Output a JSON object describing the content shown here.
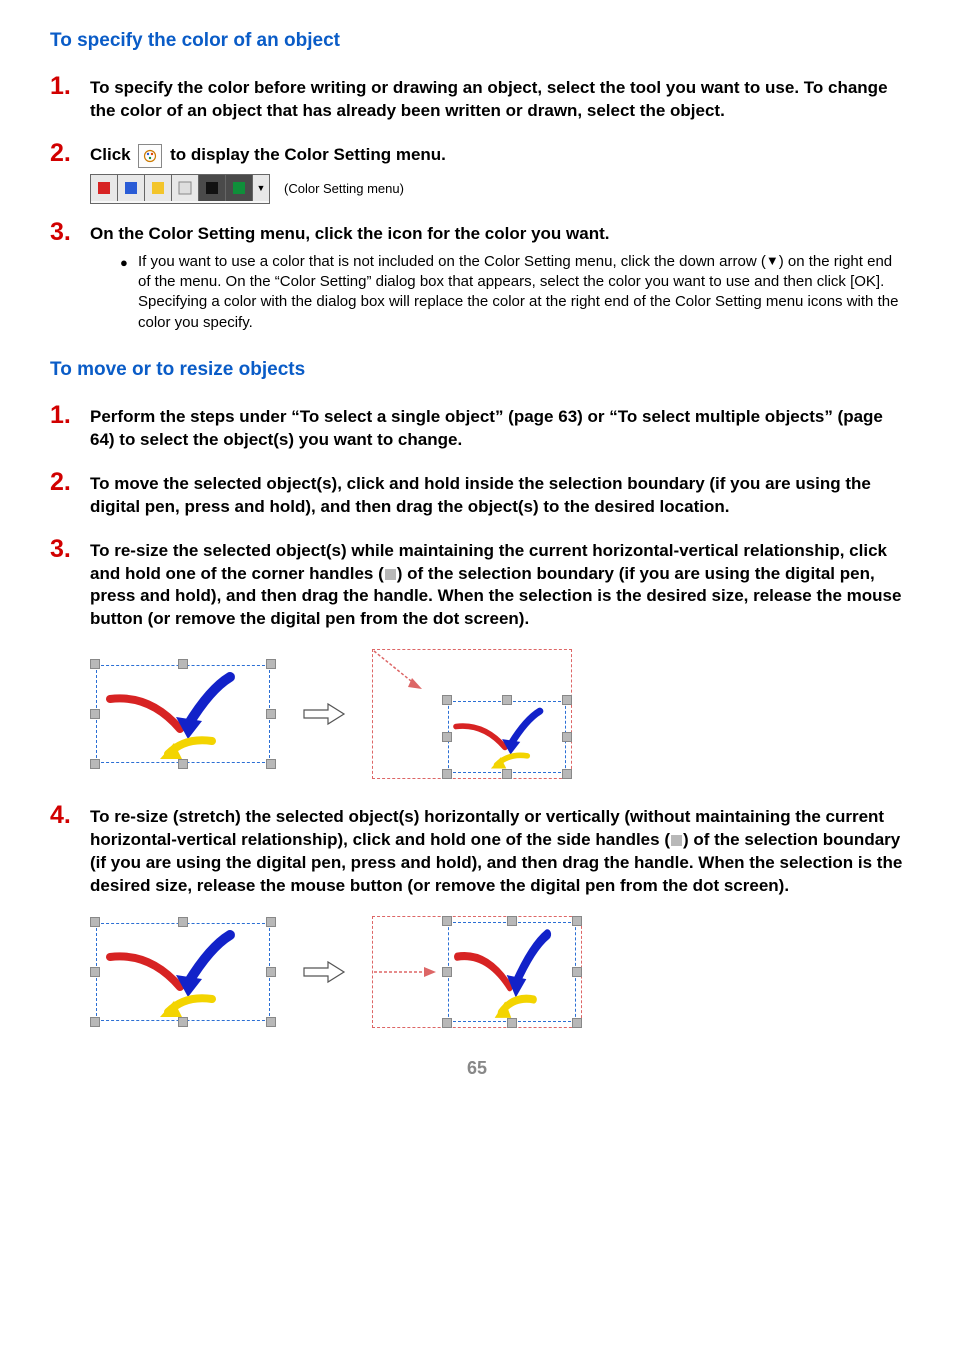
{
  "section1": {
    "heading": "To specify the color of an object",
    "step1": "To specify the color before writing or drawing an object, select the tool you want to use. To change the color of an object that has already been written or drawn, select the object.",
    "step2_pre": "Click ",
    "step2_post": " to display the Color Setting menu.",
    "menu_label": "(Color Setting menu)",
    "swatches": [
      "#d72323",
      "#2a5cd6",
      "#f3c52b",
      "#dedede",
      "#111111",
      "#0f8f3a"
    ],
    "step3": "On the Color Setting menu, click the icon for the color you want.",
    "step3_bullet_pre": "If you want to use a color that is not included on the Color Setting menu, click the down arrow (",
    "step3_bullet_post": ") on the right end of the menu. On the “Color Setting” dialog box that appears, select the color you want to use and then click [OK]. Specifying a color with the dialog box will replace the color at the right end of the Color Setting menu icons with the color you specify."
  },
  "section2": {
    "heading": "To move or to resize objects",
    "step1": "Perform the steps under “To select a single object” (page 63) or “To select multiple objects” (page 64) to select the object(s) you want to change.",
    "step2": "To move the selected object(s), click and hold inside the selection boundary (if you are using the digital pen, press and hold), and then drag the object(s) to the desired location.",
    "step3_pre": "To re-size the selected object(s) while maintaining the current horizontal-vertical relationship, click and hold one of the corner handles (",
    "step3_post": ") of the selection boundary (if you are using the digital pen, press and hold), and then drag the handle. When the selection is the desired size, release the mouse button (or remove the digital pen from the dot screen).",
    "step4_pre": "To re-size (stretch) the selected object(s) horizontally or vertically (without maintaining the current horizontal-vertical relationship), click and hold one of the side handles (",
    "step4_post": ") of the selection boundary (if you are using the digital pen, press and hold), and then drag the handle. When the selection is the desired size, release the mouse button (or remove the digital pen from the dot screen)."
  },
  "page_number": "65"
}
